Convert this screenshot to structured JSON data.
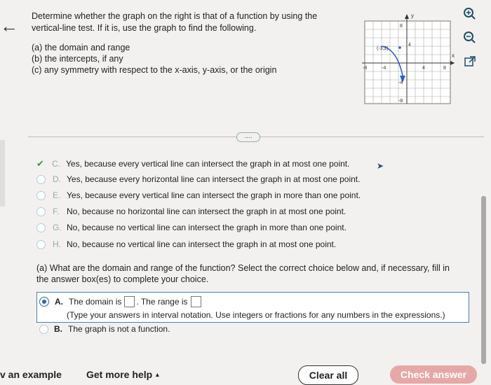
{
  "nav": {
    "back_icon": "arrow-left-icon"
  },
  "question": {
    "intro": "Determine whether the graph on the right is that of a function by using the vertical-line test. If it is, use the graph to find the following.",
    "items": [
      "(a) the domain and range",
      "(b) the intercepts, if any",
      "(c) any symmetry with respect to the x-axis, y-axis, or the origin"
    ]
  },
  "graph": {
    "y_axis_label": "y",
    "x_axis_label": "x",
    "tick_top": "8",
    "tick_right_mid": "4",
    "tick_x_left": "-8",
    "tick_x_neg4": "-4",
    "tick_x_4": "4",
    "tick_x_8": "8",
    "tick_y_neg4": "-4",
    "tick_bottom": "-8",
    "point_label": "(-3,2)"
  },
  "tools": [
    "zoom-in-icon",
    "zoom-out-icon",
    "external-link-icon"
  ],
  "more_label": "....",
  "choices": [
    {
      "letter": "C.",
      "text": "Yes, because every vertical line can intersect the graph in at most one point.",
      "checked": true
    },
    {
      "letter": "D.",
      "text": "Yes, because every horizontal line can intersect the graph in at most one point."
    },
    {
      "letter": "E.",
      "text": "Yes, because every vertical line can intersect the graph in more than one point."
    },
    {
      "letter": "F.",
      "text": "No, because no horizontal line can intersect the graph in at most one point."
    },
    {
      "letter": "G.",
      "text": "No, because no vertical line can intersect the graph in more than one point."
    },
    {
      "letter": "H.",
      "text": "No, because no vertical line can intersect the graph in at most one point."
    }
  ],
  "part_a": {
    "prompt": "(a) What are the domain and range of the function? Select the correct choice below and, if necessary, fill in the answer box(es) to complete your choice.",
    "option_a_letter": "A.",
    "option_a_domain": "The domain is",
    "option_a_range": ". The range is",
    "option_a_hint": "(Type your answers in interval notation. Use integers or fractions for any numbers in the expressions.)",
    "option_b_letter": "B.",
    "option_b_text": "The graph is not a function."
  },
  "footer": {
    "example": "v an example",
    "help": "Get more help",
    "help_arrow": "▴",
    "clear": "Clear all",
    "check": "Check answer"
  }
}
